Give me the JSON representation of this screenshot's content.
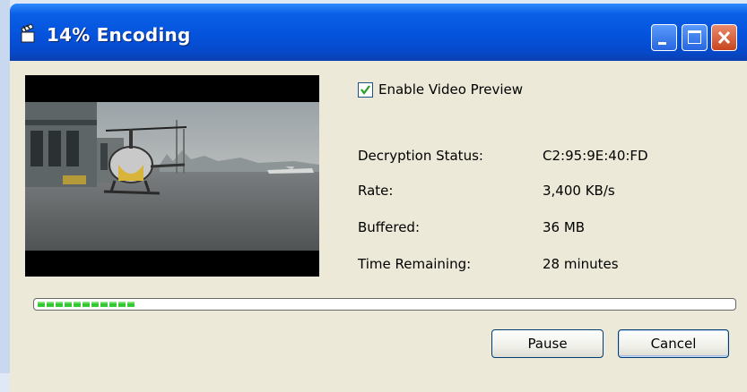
{
  "window": {
    "title": "14% Encoding",
    "app_icon": "clapperboard-icon",
    "title_buttons": [
      "minimize-icon",
      "maximize-icon",
      "close-icon"
    ]
  },
  "preview": {
    "enable_label": "Enable Video Preview",
    "enabled": true
  },
  "stats": [
    {
      "label": "Decryption Status:",
      "value": "C2:95:9E:40:FD"
    },
    {
      "label": "Rate:",
      "value": "3,400 KB/s"
    },
    {
      "label": "Buffered:",
      "value": "36 MB"
    },
    {
      "label": "Time Remaining:",
      "value": "28 minutes"
    }
  ],
  "progress": {
    "percent": 14
  },
  "buttons": {
    "pause": "Pause",
    "cancel": "Cancel"
  },
  "colors": {
    "title_bar": "#0553dd",
    "dialog_bg": "#ece9d8",
    "progress_fill": "#2cc12c",
    "close_button": "#c8451f"
  }
}
